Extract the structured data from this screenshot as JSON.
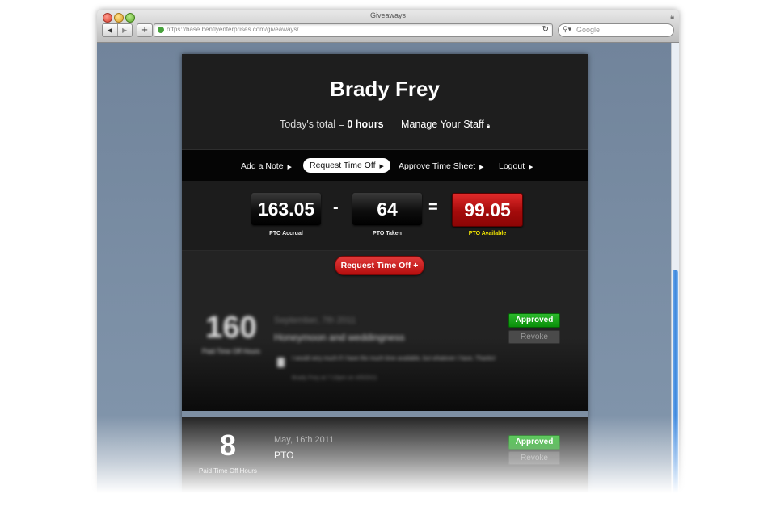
{
  "browser": {
    "window_title": "Giveaways",
    "url": "https://base.bentlyenterprises.com/giveaways/",
    "search_placeholder": "Google",
    "back_icon": "◀",
    "forward_icon": "▶",
    "add_icon": "+",
    "reload_icon": "↻"
  },
  "header": {
    "name": "Brady Frey",
    "today_prefix": "Today's total =",
    "today_value": "0 hours",
    "manage_staff": "Manage Your Staff"
  },
  "nav": {
    "items": [
      {
        "label": "Add a Note"
      },
      {
        "label": "Request Time Off",
        "active": true
      },
      {
        "label": "Approve Time Sheet"
      },
      {
        "label": "Logout"
      }
    ]
  },
  "stats": {
    "accrual": {
      "value": "163.05",
      "label": "PTO Accrual"
    },
    "minus": "-",
    "taken": {
      "value": "64",
      "label": "PTO Taken"
    },
    "equals": "=",
    "available": {
      "value": "99.05",
      "label": "PTO Available"
    }
  },
  "actions": {
    "request_button": "Request Time Off +"
  },
  "entries": [
    {
      "hours": "160",
      "hours_label": "Paid Time Off Hours",
      "date": "September, 7th 2011",
      "title": "Honeymoon and weddingness",
      "note": "I would very much if I have the much time available, but whatever I have, Thanks!",
      "note_meta": "Brady Frey at 7:10pm on 4/5/2011",
      "status": "Approved",
      "revoke": "Revoke"
    },
    {
      "hours": "8",
      "hours_label": "Paid Time Off Hours",
      "date": "May, 16th 2011",
      "title": "PTO",
      "status": "Approved",
      "revoke": "Revoke"
    }
  ],
  "colors": {
    "panel_bg": "#1e1e1e",
    "accent_red": "#c61414",
    "approved_green": "#11a011",
    "available_yellow": "#f3e600"
  }
}
